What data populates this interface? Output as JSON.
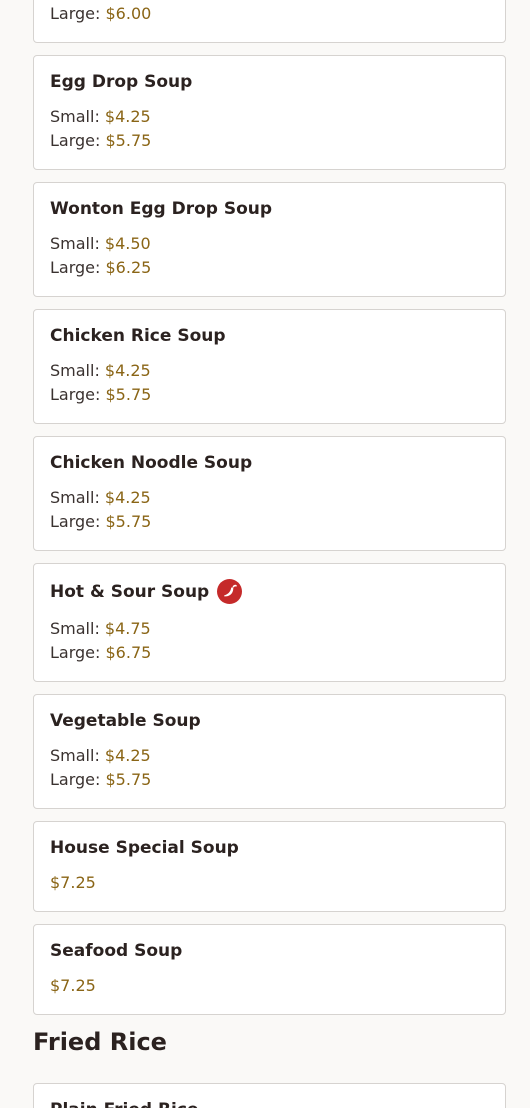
{
  "labels": {
    "small": "Small:",
    "large": "Large:"
  },
  "top_partial": {
    "large": "$6.00"
  },
  "soups": [
    {
      "name": "Egg Drop Soup",
      "small": "$4.25",
      "large": "$5.75"
    },
    {
      "name": "Wonton Egg Drop Soup",
      "small": "$4.50",
      "large": "$6.25"
    },
    {
      "name": "Chicken Rice Soup",
      "small": "$4.25",
      "large": "$5.75"
    },
    {
      "name": "Chicken Noodle Soup",
      "small": "$4.25",
      "large": "$5.75"
    },
    {
      "name": "Hot & Sour Soup",
      "small": "$4.75",
      "large": "$6.75",
      "icon": "spicy-chili-icon"
    },
    {
      "name": "Vegetable Soup",
      "small": "$4.25",
      "large": "$5.75"
    },
    {
      "name": "House Special Soup",
      "price": "$7.25"
    },
    {
      "name": "Seafood Soup",
      "price": "$7.25"
    }
  ],
  "section": {
    "title": "Fried Rice"
  },
  "fried_rice_first": {
    "name": "Plain Fried Rice"
  },
  "colors": {
    "price": "#8a6516",
    "spicy": "#c52a2a",
    "border": "#d6d3d0"
  }
}
